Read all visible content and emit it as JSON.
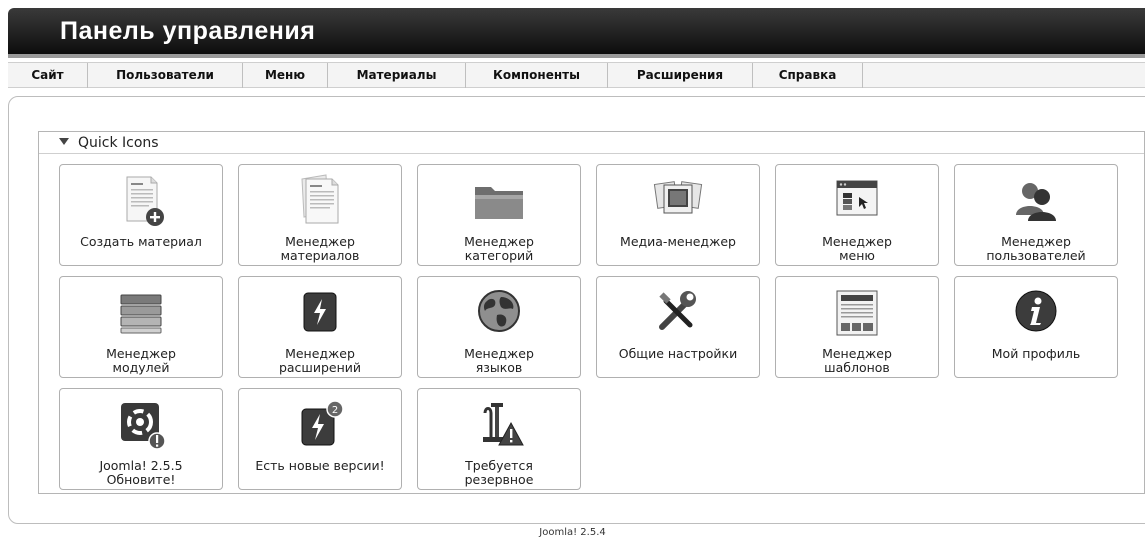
{
  "header": {
    "title": "Панель управления"
  },
  "menu": {
    "items": [
      {
        "label": "Сайт"
      },
      {
        "label": "Пользователи"
      },
      {
        "label": "Меню"
      },
      {
        "label": "Материалы"
      },
      {
        "label": "Компоненты"
      },
      {
        "label": "Расширения"
      },
      {
        "label": "Справка"
      }
    ]
  },
  "panel": {
    "title": "Quick Icons"
  },
  "tiles": [
    {
      "label": "Создать материал",
      "icon": "add-article-icon"
    },
    {
      "label": "Менеджер\nматериалов",
      "icon": "article-icon"
    },
    {
      "label": "Менеджер\nкатегорий",
      "icon": "folder-icon"
    },
    {
      "label": "Медиа-менеджер",
      "icon": "media-icon"
    },
    {
      "label": "Менеджер\nменю",
      "icon": "menu-window-icon"
    },
    {
      "label": "Менеджер\nпользователей",
      "icon": "users-icon"
    },
    {
      "label": "Менеджер\nмодулей",
      "icon": "modules-icon"
    },
    {
      "label": "Менеджер\nрасширений",
      "icon": "extensions-icon"
    },
    {
      "label": "Менеджер\nязыков",
      "icon": "globe-icon"
    },
    {
      "label": "Общие настройки",
      "icon": "tools-icon"
    },
    {
      "label": "Менеджер\nшаблонов",
      "icon": "template-icon"
    },
    {
      "label": "Мой профиль",
      "icon": "info-icon"
    },
    {
      "label": "Joomla! 2.5.5\nОбновите!",
      "icon": "joomla-update-icon"
    },
    {
      "label": "Есть новые версии!",
      "icon": "extension-updates-icon"
    },
    {
      "label": "Требуется\nрезервное\nкопирование",
      "icon": "backup-warning-icon"
    }
  ],
  "footer": {
    "version": "Joomla! 2.5.4"
  }
}
